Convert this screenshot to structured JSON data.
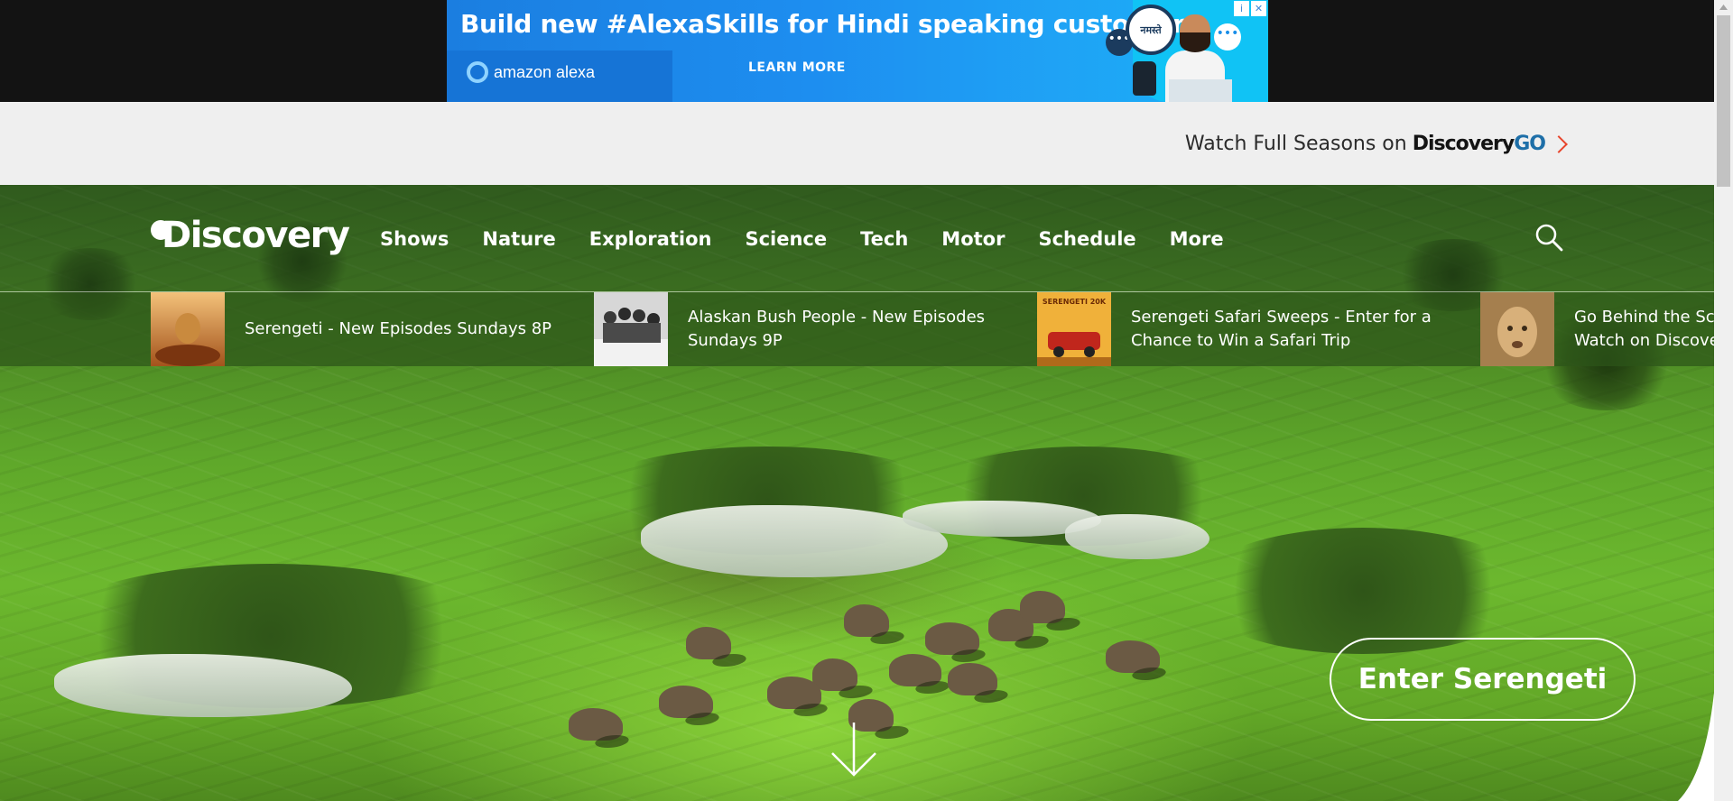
{
  "ad": {
    "headline": "Build new #AlexaSkills for Hindi speaking customers",
    "brand": "amazon alexa",
    "cta": "LEARN MORE",
    "bubble_text": "नमस्ते",
    "info_icon": "i",
    "close_icon": "✕"
  },
  "watchbar": {
    "text": "Watch Full Seasons on",
    "logo_main": "Discovery",
    "logo_go": "GO"
  },
  "header": {
    "logo": "Discovery",
    "nav": [
      "Shows",
      "Nature",
      "Exploration",
      "Science",
      "Tech",
      "Motor",
      "Schedule",
      "More"
    ]
  },
  "promos": [
    {
      "title": "Serengeti - New Episodes Sundays 8P",
      "thumb": "lion-cub-thumbnail"
    },
    {
      "title": "Alaskan Bush People - New Episodes Sundays 9P",
      "thumb": "alaskan-family-thumbnail"
    },
    {
      "title": "Serengeti Safari Sweeps - Enter for a Chance to Win a Safari Trip",
      "thumb": "serengeti-20k-jeep-thumbnail",
      "thumb_text": "SERENGETI 20K"
    },
    {
      "title": "Go Behind the Scenes of Serengeti - Watch on Discovery GO",
      "thumb": "lioness-thumbnail"
    }
  ],
  "hero": {
    "cta": "Enter Serengeti"
  },
  "colors": {
    "ad_blue": "#1d8ef0",
    "topbar": "#131313",
    "watchbar": "#efefef",
    "go_accent": "#e8452c",
    "grass": "#6cb82e"
  }
}
